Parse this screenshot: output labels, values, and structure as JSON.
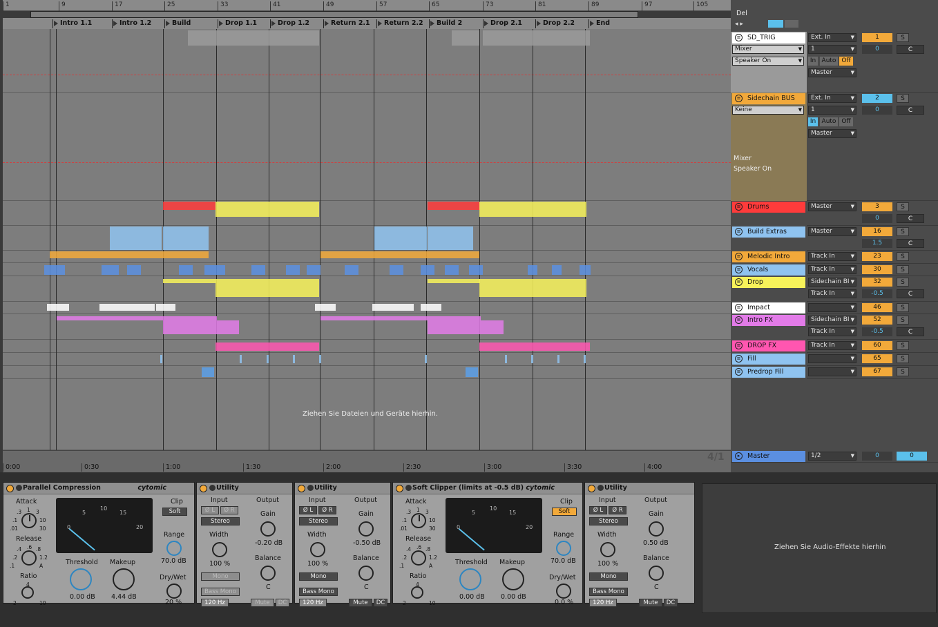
{
  "ruler": {
    "bars": [
      "1",
      "9",
      "17",
      "25",
      "33",
      "41",
      "49",
      "57",
      "65",
      "73",
      "81",
      "89",
      "97",
      "105"
    ]
  },
  "locators": [
    "Intro 1.1",
    "Intro 1.2",
    "Build",
    "Drop 1.1",
    "Drop 1.2",
    "Return 2.1",
    "Return 2.2",
    "Build 2",
    "Drop 2.1",
    "Drop 2.2",
    "End"
  ],
  "arrangement": {
    "drop_hint": "Ziehen Sie Dateien und Geräte hierhin."
  },
  "time_ruler": {
    "marks": [
      "0:00",
      "0:30",
      "1:00",
      "1:30",
      "2:00",
      "2:30",
      "3:00",
      "3:30",
      "4:00"
    ],
    "signature": "4/1"
  },
  "mixer": {
    "top_buttons": {
      "del": "Del"
    },
    "tracks": [
      {
        "name": "SD_TRIG",
        "color": "#ffffff",
        "input": "Ext. In",
        "channel": "1",
        "mixer": "Mixer",
        "speaker": "Speaker On",
        "monitor": [
          "In",
          "Auto",
          "Off"
        ],
        "output": "Master",
        "number": "1",
        "pan": "0",
        "solo": "S",
        "center": "C"
      },
      {
        "name": "Sidechain BUS",
        "color": "#f2a93a",
        "input": "Ext. In",
        "channel": "1",
        "mixer": "Keine",
        "speaker": "Speaker On",
        "mixer_label": "Mixer",
        "monitor": [
          "In",
          "Auto",
          "Off"
        ],
        "output": "Master",
        "number": "2",
        "pan": "0",
        "solo": "S",
        "center": "C"
      },
      {
        "name": "Drums",
        "color": "#ff3b3b",
        "output": "Master",
        "number": "3",
        "pan": "0",
        "solo": "S",
        "center": "C"
      },
      {
        "name": "Build Extras",
        "color": "#8fc3f0",
        "output": "Master",
        "number": "16",
        "pan": "1.5",
        "solo": "S",
        "center": "C"
      },
      {
        "name": "Melodic Intro",
        "color": "#f2a93a",
        "output": "Track In",
        "number": "23",
        "solo": "S"
      },
      {
        "name": "Vocals",
        "color": "#8fc3f0",
        "output": "Track In",
        "number": "30",
        "solo": "S"
      },
      {
        "name": "Drop",
        "color": "#f7f25a",
        "output": "Sidechain BI",
        "input2": "Track In",
        "number": "32",
        "pan": "-0.5",
        "solo": "S",
        "center": "C"
      },
      {
        "name": "Impact",
        "color": "#ffffff",
        "output": "",
        "number": "46",
        "solo": "S"
      },
      {
        "name": "Intro FX",
        "color": "#e27be8",
        "output": "Sidechain BI",
        "input2": "Track In",
        "number": "52",
        "pan": "-0.5",
        "solo": "S",
        "center": "C"
      },
      {
        "name": "DROP FX",
        "color": "#ff56b0",
        "output": "Track In",
        "number": "60",
        "solo": "S"
      },
      {
        "name": "Fill",
        "color": "#8fc3f0",
        "output": "",
        "number": "65",
        "solo": "S"
      },
      {
        "name": "Predrop Fill",
        "color": "#8fc3f0",
        "output": "",
        "number": "67",
        "solo": "S"
      }
    ],
    "master": {
      "name": "Master",
      "output": "1/2",
      "pan": "0",
      "vol": "0"
    }
  },
  "devices": [
    {
      "title": "Parallel Compression",
      "brand": "cytomic",
      "attack": "Attack",
      "release": "Release",
      "ratio": "Ratio",
      "clip": "Clip",
      "clip_mode": "Soft",
      "range": "Range",
      "range_val": "70.0 dB",
      "drywet": "Dry/Wet",
      "drywet_val": "20 %",
      "threshold": "Threshold",
      "threshold_val": "0.00 dB",
      "makeup": "Makeup",
      "makeup_val": "4.44 dB",
      "attack_ticks": [
        "1",
        ".3",
        "3",
        ".1",
        "10",
        ".01",
        "30"
      ],
      "release_ticks": [
        ".6",
        ".4",
        ".8",
        ".2",
        "1.2",
        ".1",
        "A"
      ],
      "ratio_ticks": [
        "4",
        "2",
        "10"
      ],
      "meter_ticks": [
        "5",
        "10",
        "15",
        "0",
        "20"
      ]
    },
    {
      "title": "Utility",
      "input": "Input",
      "output": "Output",
      "phase_l": "Ø L",
      "phase_r": "Ø R",
      "stereo": "Stereo",
      "gain": "Gain",
      "gain_val": "-0.20 dB",
      "width": "Width",
      "width_val": "100 %",
      "balance": "Balance",
      "balance_val": "C",
      "mono": "Mono",
      "bass_mono": "Bass Mono",
      "hz": "120 Hz",
      "mute": "Mute",
      "dc": "DC"
    },
    {
      "title": "Utility",
      "input": "Input",
      "output": "Output",
      "phase_l": "Ø L",
      "phase_r": "Ø R",
      "stereo": "Stereo",
      "gain": "Gain",
      "gain_val": "-0.50 dB",
      "width": "Width",
      "width_val": "100 %",
      "balance": "Balance",
      "balance_val": "C",
      "mono": "Mono",
      "bass_mono": "Bass Mono",
      "hz": "120 Hz",
      "mute": "Mute",
      "dc": "DC"
    },
    {
      "title": "Soft Clipper (limits at -0.5 dB)",
      "brand": "cytomic",
      "attack": "Attack",
      "release": "Release",
      "ratio": "Ratio",
      "clip": "Clip",
      "clip_mode": "Soft",
      "range": "Range",
      "range_val": "70.0 dB",
      "drywet": "Dry/Wet",
      "drywet_val": "0.0 %",
      "threshold": "Threshold",
      "threshold_val": "0.00 dB",
      "makeup": "Makeup",
      "makeup_val": "0.00 dB",
      "attack_ticks": [
        "1",
        ".3",
        "3",
        ".1",
        "10",
        ".01",
        "30"
      ],
      "release_ticks": [
        ".6",
        ".4",
        ".8",
        ".2",
        "1.2",
        ".1",
        "A"
      ],
      "ratio_ticks": [
        "4",
        "2",
        "10"
      ],
      "meter_ticks": [
        "5",
        "10",
        "15",
        "0",
        "20"
      ]
    },
    {
      "title": "Utility",
      "input": "Input",
      "output": "Output",
      "phase_l": "Ø L",
      "phase_r": "Ø R",
      "stereo": "Stereo",
      "gain": "Gain",
      "gain_val": "0.50 dB",
      "width": "Width",
      "width_val": "100 %",
      "balance": "Balance",
      "balance_val": "C",
      "mono": "Mono",
      "bass_mono": "Bass Mono",
      "hz": "120 Hz",
      "mute": "Mute",
      "dc": "DC"
    }
  ],
  "fx_drop_hint": "Ziehen Sie Audio-Effekte hierhin"
}
